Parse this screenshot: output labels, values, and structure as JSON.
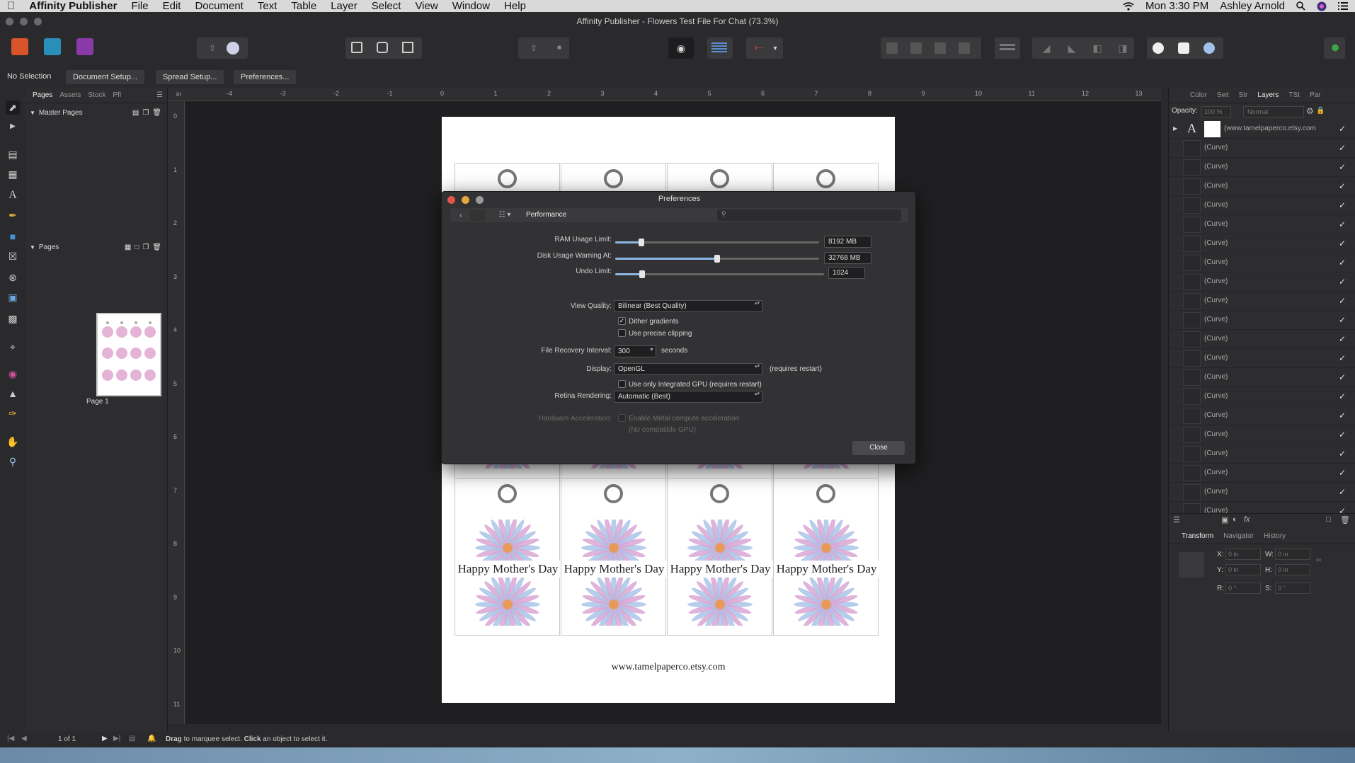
{
  "menubar": {
    "app_name": "Affinity Publisher",
    "menus": [
      "File",
      "Edit",
      "Document",
      "Text",
      "Table",
      "Layer",
      "Select",
      "View",
      "Window",
      "Help"
    ],
    "clock": "Mon 3:30 PM",
    "user": "Ashley Arnold"
  },
  "window": {
    "title": "Affinity Publisher - Flowers Test File For Chat (73.3%)"
  },
  "context_toolbar": {
    "selection": "No Selection",
    "document_setup": "Document Setup...",
    "spread_setup": "Spread Setup...",
    "preferences": "Preferences..."
  },
  "left_panel": {
    "tabs": [
      "Pages",
      "Assets",
      "Stock",
      "Pfl"
    ],
    "master_pages_label": "Master Pages",
    "pages_label": "Pages",
    "page_name": "Page 1"
  },
  "ruler": {
    "h_unit": "in",
    "h_ticks": [
      "-4",
      "-3",
      "-2",
      "-1",
      "0",
      "1",
      "2",
      "3",
      "4",
      "5",
      "6",
      "7",
      "8",
      "9",
      "10",
      "11",
      "12",
      "13"
    ],
    "v_ticks": [
      "0",
      "1",
      "2",
      "3",
      "4",
      "5",
      "6",
      "7",
      "8",
      "9",
      "10",
      "11"
    ]
  },
  "document": {
    "tag_text": "Happy Mother's Day",
    "footer_url": "www.tamelpaperco.etsy.com"
  },
  "preferences": {
    "title": "Preferences",
    "section": "Performance",
    "search_placeholder": "",
    "ram_label": "RAM Usage Limit:",
    "ram_value": "8192 MB",
    "ram_fraction": 0.13,
    "disk_label": "Disk Usage Warning At:",
    "disk_value": "32768 MB",
    "disk_fraction": 0.5,
    "undo_label": "Undo Limit:",
    "undo_value": "1024",
    "undo_fraction": 0.13,
    "view_quality_label": "View Quality:",
    "view_quality_value": "Bilinear (Best Quality)",
    "dither_label": "Dither gradients",
    "dither_checked": true,
    "precise_clip_label": "Use precise clipping",
    "precise_clip_checked": false,
    "recovery_label": "File Recovery Interval:",
    "recovery_value": "300",
    "recovery_unit": "seconds",
    "display_label": "Display:",
    "display_value": "OpenGL",
    "display_note": "(requires restart)",
    "integrated_gpu_label": "Use only Integrated GPU (requires restart)",
    "retina_label": "Retina Rendering:",
    "retina_value": "Automatic (Best)",
    "hw_label": "Hardware Acceleration:",
    "metal_label": "Enable Metal compute acceleration",
    "no_gpu_note": "(No compatible GPU)",
    "close_button": "Close"
  },
  "right_panel": {
    "tabs": [
      "Color",
      "Swt",
      "Str",
      "Layers",
      "TSt",
      "Par"
    ],
    "opacity_label": "Opacity:",
    "opacity_value": "100 %",
    "blend_value": "Normal",
    "first_layer": "(www.tamelpaperco.etsy.com",
    "curve_label": "(Curve)",
    "bottom_tabs": [
      "Transform",
      "Navigator",
      "History"
    ],
    "x_label": "X:",
    "y_label": "Y:",
    "w_label": "W:",
    "h_label": "H:",
    "r_label": "R:",
    "s_label": "S:",
    "x_value": "0 in",
    "y_value": "0 in",
    "w_value": "0 in",
    "h_value": "0 in",
    "r_value": "0 °",
    "s_value": "0 °"
  },
  "status": {
    "page_counter": "1 of 1",
    "hint_drag": "Drag",
    "hint_mid": " to marquee select. ",
    "hint_click": "Click",
    "hint_end": " an object to select it."
  },
  "colors": {
    "accent_blue": "#8ab8e6",
    "close_red": "#e5534b",
    "minimize_yellow": "#e6a73a",
    "zoom_green": "#4aa957"
  }
}
